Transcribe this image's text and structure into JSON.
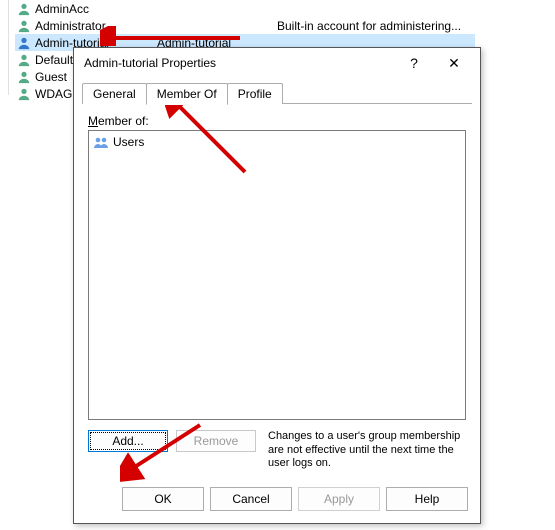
{
  "users": [
    {
      "name": "AdminAcc",
      "full": "",
      "desc": ""
    },
    {
      "name": "Administrator",
      "full": "",
      "desc": "Built-in account for administering..."
    },
    {
      "name": "Admin-tutorial",
      "full": "Admin-tutorial",
      "desc": "",
      "selected": true
    },
    {
      "name": "DefaultA",
      "full": "",
      "desc": ""
    },
    {
      "name": "Guest",
      "full": "",
      "desc": ""
    },
    {
      "name": "WDAGU",
      "full": "",
      "desc": ""
    }
  ],
  "dialog": {
    "title": "Admin-tutorial Properties",
    "help_symbol": "?",
    "close_symbol": "✕",
    "tabs": {
      "general": "General",
      "member_of": "Member Of",
      "profile": "Profile"
    },
    "member_label": "Member of:",
    "groups": [
      "Users"
    ],
    "add_label": "Add...",
    "remove_label": "Remove",
    "hint": "Changes to a user's group membership are not effective until the next time the user logs on.",
    "ok": "OK",
    "cancel": "Cancel",
    "apply": "Apply",
    "help": "Help"
  },
  "arrow_color": "#d40000"
}
